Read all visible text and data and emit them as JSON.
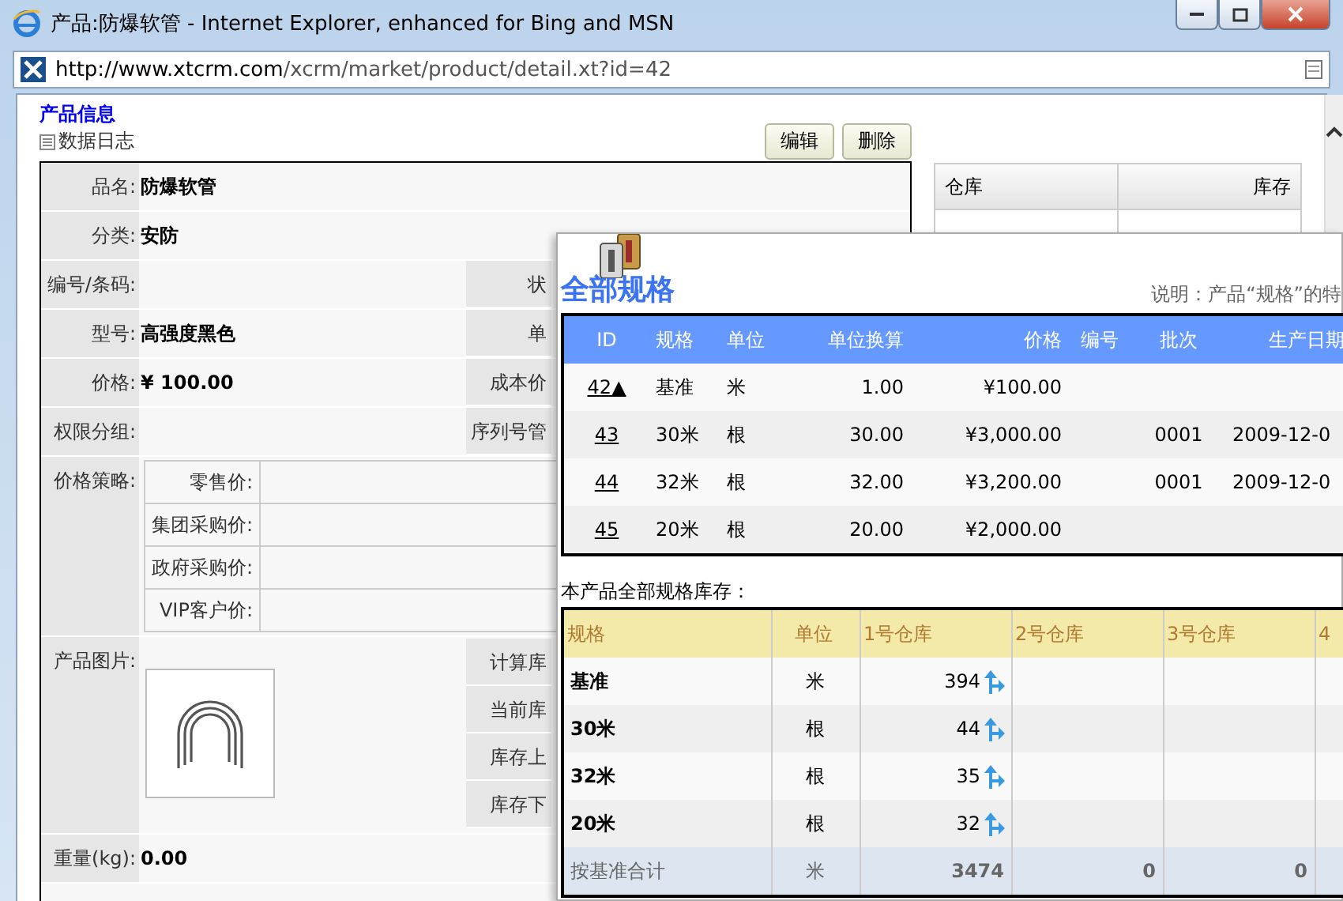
{
  "window": {
    "title": "产品:防爆软管 - Internet Explorer, enhanced for Bing and MSN",
    "address_host": "http://www.xtcrm.com",
    "address_path": "/xcrm/market/product/detail.xt?id=42"
  },
  "page": {
    "heading": "产品信息",
    "log_link": "数据日志",
    "buttons": [
      "编辑",
      "删除"
    ]
  },
  "form": {
    "rows": [
      {
        "kind": "text",
        "label": "品名:",
        "value": "防爆软管"
      },
      {
        "kind": "text",
        "label": "分类:",
        "value": "安防"
      },
      {
        "kind": "text",
        "label": "编号/条码:",
        "side_label": "状"
      },
      {
        "kind": "text",
        "label": "型号:",
        "value": "高强度黑色",
        "side_label": "单"
      },
      {
        "kind": "text",
        "label": "价格:",
        "value": "¥ **100.00**",
        "side_label": "成本价"
      },
      {
        "kind": "text",
        "label": "权限分组:",
        "side_label": "序列号管"
      },
      {
        "kind": "strategy",
        "label": "价格策略:",
        "items": [
          "零售价:",
          "集团采购价:",
          "政府采购价:",
          "VIP客户价:"
        ]
      },
      {
        "kind": "image",
        "label": "产品图片:",
        "side_labels": [
          "计算库",
          "当前库",
          "库存上",
          "库存下"
        ]
      },
      {
        "kind": "text",
        "label": "重量(kg):",
        "value": "0.00"
      }
    ]
  },
  "stock": {
    "columns": [
      "仓库",
      "库存"
    ]
  },
  "popup": {
    "title": "全部规格",
    "note": "说明：产品“规格”的特",
    "specs": {
      "columns": [
        "ID",
        "规格",
        "单位",
        "单位换算",
        "价格",
        "编号",
        "批次",
        "生产日期"
      ],
      "rows": [
        {
          "id": "42▲",
          "spec": "基准",
          "unit": "米",
          "ratio": "1.00",
          "price": "¥100.00"
        },
        {
          "id": "43",
          "spec": "30米",
          "unit": "根",
          "ratio": "30.00",
          "price": "¥3,000.00",
          "batch": "0001",
          "date": "2009-12-0"
        },
        {
          "id": "44",
          "spec": "32米",
          "unit": "根",
          "ratio": "32.00",
          "price": "¥3,200.00",
          "batch": "0001",
          "date": "2009-12-0"
        },
        {
          "id": "45",
          "spec": "20米",
          "unit": "根",
          "ratio": "20.00",
          "price": "¥2,000.00"
        }
      ]
    },
    "inventory": {
      "caption": "本产品全部规格库存：",
      "columns": [
        "规格",
        "单位",
        "1号仓库",
        "2号仓库",
        "3号仓库",
        "4"
      ],
      "rows": [
        {
          "spec": "基准",
          "unit": "米",
          "stocks": [
            "394"
          ]
        },
        {
          "spec": "30米",
          "unit": "根",
          "stocks": [
            "44"
          ]
        },
        {
          "spec": "32米",
          "unit": "根",
          "stocks": [
            "35"
          ]
        },
        {
          "spec": "20米",
          "unit": "根",
          "stocks": [
            "32"
          ]
        }
      ],
      "total": {
        "label": "按基准合计",
        "unit": "米",
        "values": [
          "3474",
          "0",
          "0"
        ]
      }
    }
  }
}
